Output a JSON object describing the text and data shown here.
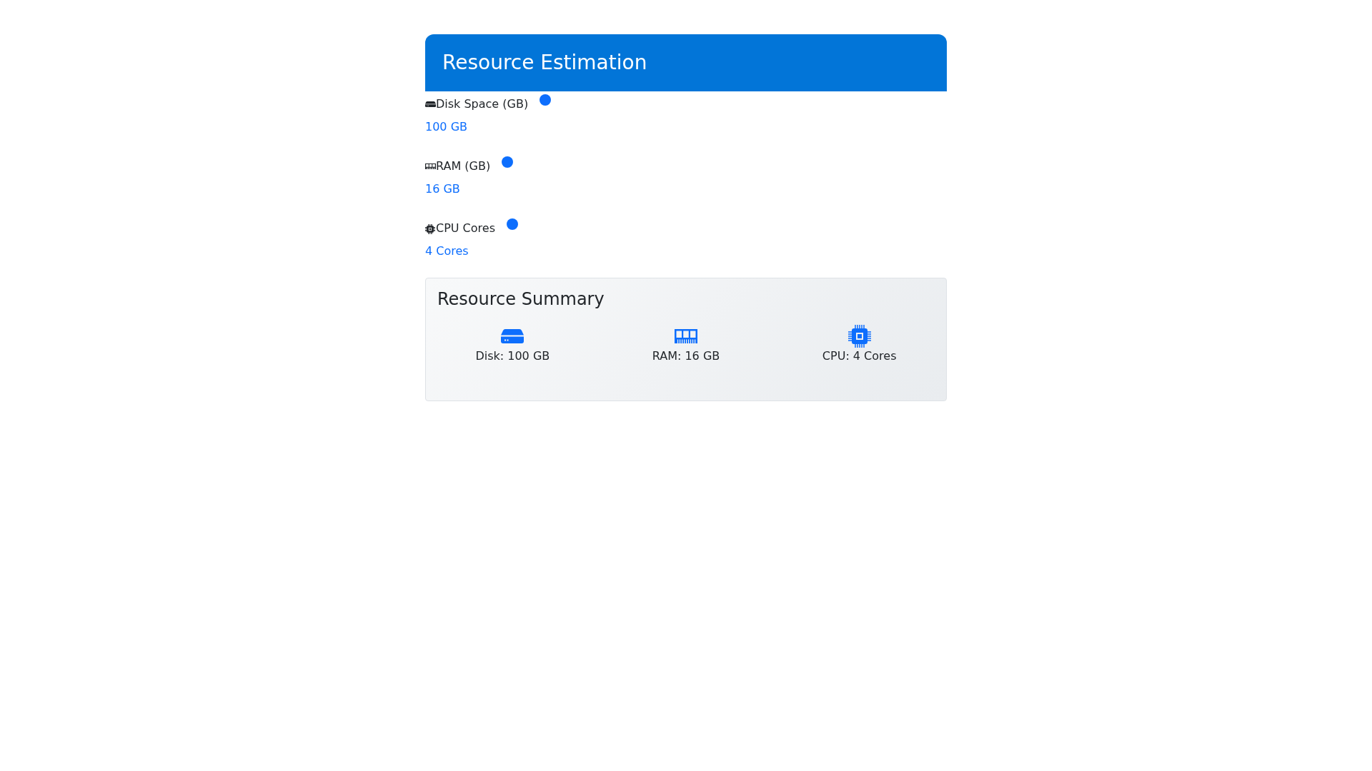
{
  "header": {
    "title": "Resource Estimation"
  },
  "resources": [
    {
      "kind": "disk",
      "label": "Disk Space (GB)",
      "value": "100 GB"
    },
    {
      "kind": "ram",
      "label": "RAM (GB)",
      "value": "16 GB"
    },
    {
      "kind": "cpu",
      "label": "CPU Cores",
      "value": "4 Cores"
    }
  ],
  "summary": {
    "title": "Resource Summary",
    "items": [
      {
        "kind": "disk",
        "text": "Disk: 100 GB"
      },
      {
        "kind": "ram",
        "text": "RAM: 16 GB"
      },
      {
        "kind": "cpu",
        "text": "CPU: 4 Cores"
      }
    ]
  }
}
